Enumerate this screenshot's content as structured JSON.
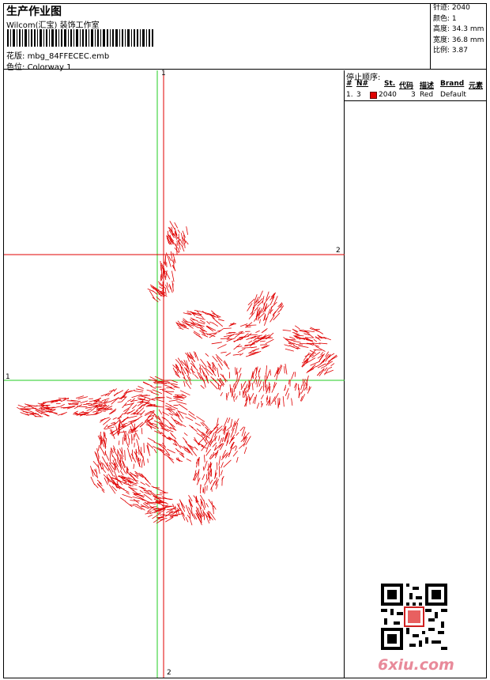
{
  "header": {
    "title": "生产作业图",
    "subtitle": "Wilcom(汇宝) 装饰工作室",
    "file_label": "花版:",
    "file_name": "mbg_84FFECEC.emb",
    "colorway_label": "色位:",
    "colorway_name": "Colorway 1"
  },
  "stats": [
    {
      "label": "针迹:",
      "value": "2040"
    },
    {
      "label": "颜色:",
      "value": "1"
    },
    {
      "label": "高度:",
      "value": "34.3 mm"
    },
    {
      "label": "宽度:",
      "value": "36.8 mm"
    },
    {
      "label": "比例:",
      "value": "3.87"
    }
  ],
  "axes": {
    "vertical_top": "1",
    "vertical_bottom": "2",
    "horizontal_left": "1",
    "horizontal_right": "2"
  },
  "stop_sequence": {
    "title": "停止顺序:",
    "headers": [
      "#",
      "N#",
      "St.",
      "代码",
      "描述",
      "Brand",
      "元素"
    ],
    "rows": [
      {
        "index": "1.",
        "n": "3",
        "stitches": "2040",
        "code": "3",
        "description": "Red",
        "brand": "Default",
        "element": ""
      }
    ]
  },
  "colors": {
    "thread": "#e00000",
    "guide_green": "#22cc22",
    "guide_red": "#e00000"
  },
  "watermark": "6xiu.com"
}
